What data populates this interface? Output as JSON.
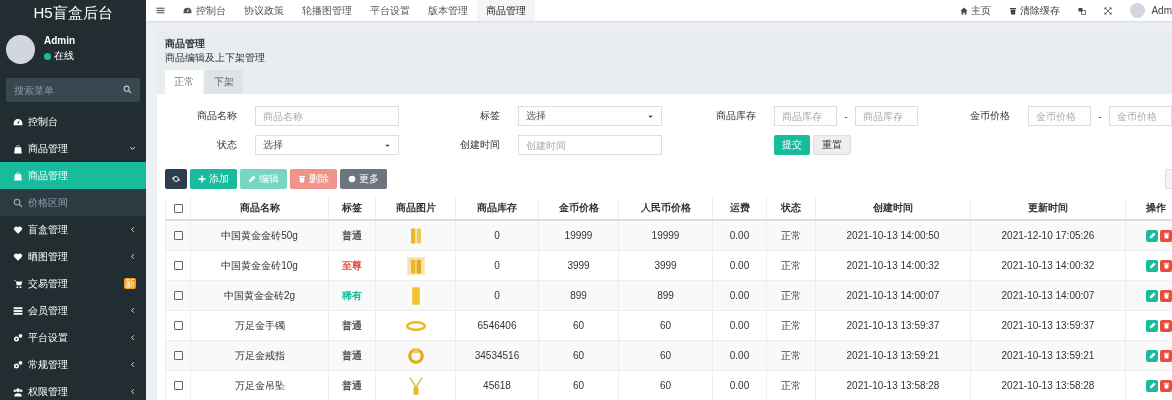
{
  "brand": "H5盲盒后台",
  "user": {
    "name": "Admin",
    "status": "在线"
  },
  "menu_search": {
    "placeholder": "搜索菜单"
  },
  "sidebar_items": [
    {
      "kind": "link",
      "label": "控制台",
      "selected": false
    },
    {
      "kind": "group",
      "label": "商品管理",
      "expanded": true,
      "children": [
        {
          "label": "商品管理",
          "selected": true
        },
        {
          "label": "价格区间",
          "selected": false
        }
      ]
    },
    {
      "kind": "group",
      "label": "盲盒管理",
      "expanded": false
    },
    {
      "kind": "group",
      "label": "晒图管理",
      "expanded": false
    },
    {
      "kind": "badge",
      "label": "交易管理",
      "badge": "新"
    },
    {
      "kind": "group",
      "label": "会员管理",
      "expanded": false
    },
    {
      "kind": "group",
      "label": "平台设置",
      "expanded": false
    },
    {
      "kind": "group",
      "label": "常规管理",
      "expanded": false
    },
    {
      "kind": "group",
      "label": "权限管理",
      "expanded": false
    }
  ],
  "nav_tabs": [
    {
      "label": "控制台",
      "selected": false
    },
    {
      "label": "协议政策",
      "selected": false
    },
    {
      "label": "轮播图管理",
      "selected": false
    },
    {
      "label": "平台设置",
      "selected": false
    },
    {
      "label": "版本管理",
      "selected": false
    },
    {
      "label": "商品管理",
      "selected": true
    }
  ],
  "nav_right": {
    "home": "主页",
    "clear_cache": "清除缓存",
    "user": "Adm"
  },
  "page": {
    "title": "商品管理",
    "subtitle": "商品编辑及上下架管理"
  },
  "panel_tabs": [
    {
      "label": "正常",
      "selected": true
    },
    {
      "label": "下架",
      "selected": false
    }
  ],
  "filters": [
    {
      "kind": "text",
      "label": "商品名称",
      "placeholder": "商品名称"
    },
    {
      "kind": "select",
      "label": "标签",
      "value": "选择"
    },
    {
      "kind": "range",
      "label": "商品库存",
      "from": {
        "placeholder": "商品库存"
      },
      "separator": "-",
      "to": {
        "placeholder": "商品库存"
      }
    },
    {
      "kind": "range",
      "label": "金币价格",
      "from": {
        "placeholder": "金币价格"
      },
      "separator": "-",
      "to": {
        "placeholder": "金币价格"
      }
    },
    {
      "kind": "select",
      "label": "状态",
      "value": "选择"
    },
    {
      "kind": "text",
      "label": "创建时间",
      "placeholder": "创建时间"
    },
    {
      "kind": "buttons",
      "submit": "提交",
      "reset": "重置"
    }
  ],
  "toolbar": [
    {
      "kind": "refresh",
      "disabled": false
    },
    {
      "kind": "add",
      "label": "添加",
      "disabled": false
    },
    {
      "kind": "edit",
      "label": "编辑",
      "disabled": true
    },
    {
      "kind": "delete",
      "label": "删除",
      "disabled": true
    },
    {
      "kind": "more",
      "label": "更多",
      "disabled": false
    }
  ],
  "table": {
    "columns": [
      "商品名称",
      "标签",
      "商品图片",
      "商品库存",
      "金币价格",
      "人民币价格",
      "运费",
      "状态",
      "创建时间",
      "更新时间",
      "操作"
    ],
    "all_checked": false,
    "rows": [
      {
        "checked": false,
        "name": "中国黄金金砖50g",
        "tag": {
          "label": "普通",
          "color": "#555555"
        },
        "stock": "0",
        "gold": "19999",
        "rmb": "19999",
        "freight": "0.00",
        "status": "正常",
        "created": "2021-10-13 14:00:50",
        "updated": "2021-12-10 17:05:26"
      },
      {
        "checked": false,
        "name": "中国黄金金砖10g",
        "tag": {
          "label": "至尊",
          "color": "#e74c3c"
        },
        "stock": "0",
        "gold": "3999",
        "rmb": "3999",
        "freight": "0.00",
        "status": "正常",
        "created": "2021-10-13 14:00:32",
        "updated": "2021-10-13 14:00:32"
      },
      {
        "checked": false,
        "name": "中国黄金金砖2g",
        "tag": {
          "label": "稀有",
          "color": "#18bc9c"
        },
        "stock": "0",
        "gold": "899",
        "rmb": "899",
        "freight": "0.00",
        "status": "正常",
        "created": "2021-10-13 14:00:07",
        "updated": "2021-10-13 14:00:07"
      },
      {
        "checked": false,
        "name": "万足金手镯",
        "tag": {
          "label": "普通",
          "color": "#555555"
        },
        "stock": "6546406",
        "gold": "60",
        "rmb": "60",
        "freight": "0.00",
        "status": "正常",
        "created": "2021-10-13 13:59:37",
        "updated": "2021-10-13 13:59:37"
      },
      {
        "checked": false,
        "name": "万足金戒指",
        "tag": {
          "label": "普通",
          "color": "#555555"
        },
        "stock": "34534516",
        "gold": "60",
        "rmb": "60",
        "freight": "0.00",
        "status": "正常",
        "created": "2021-10-13 13:59:21",
        "updated": "2021-10-13 13:59:21"
      },
      {
        "checked": false,
        "name": "万足金吊坠",
        "tag": {
          "label": "普通",
          "color": "#555555"
        },
        "stock": "45618",
        "gold": "60",
        "rmb": "60",
        "freight": "0.00",
        "status": "正常",
        "created": "2021-10-13 13:58:28",
        "updated": "2021-10-13 13:58:28"
      }
    ]
  }
}
